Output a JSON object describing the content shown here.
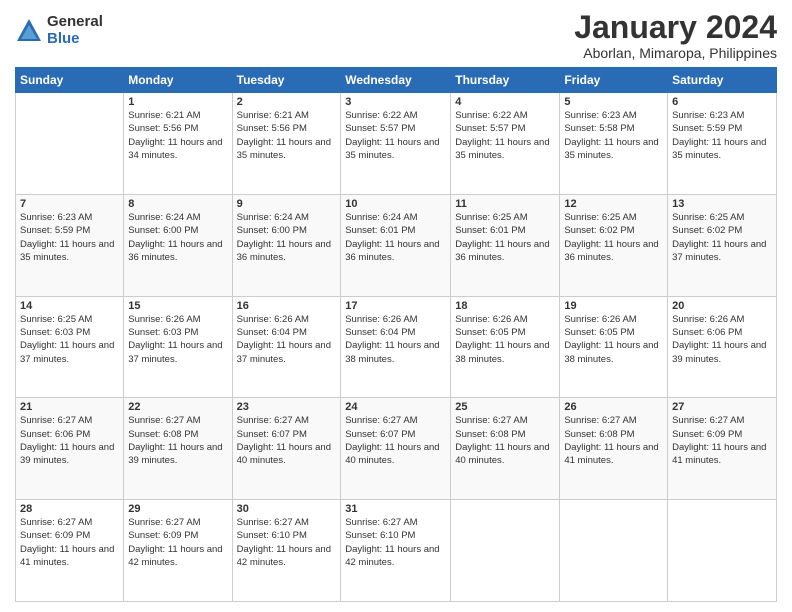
{
  "logo": {
    "general": "General",
    "blue": "Blue"
  },
  "header": {
    "title": "January 2024",
    "subtitle": "Aborlan, Mimaropa, Philippines"
  },
  "columns": [
    "Sunday",
    "Monday",
    "Tuesday",
    "Wednesday",
    "Thursday",
    "Friday",
    "Saturday"
  ],
  "weeks": [
    [
      {
        "day": "",
        "sunrise": "",
        "sunset": "",
        "daylight": ""
      },
      {
        "day": "1",
        "sunrise": "Sunrise: 6:21 AM",
        "sunset": "Sunset: 5:56 PM",
        "daylight": "Daylight: 11 hours and 34 minutes."
      },
      {
        "day": "2",
        "sunrise": "Sunrise: 6:21 AM",
        "sunset": "Sunset: 5:56 PM",
        "daylight": "Daylight: 11 hours and 35 minutes."
      },
      {
        "day": "3",
        "sunrise": "Sunrise: 6:22 AM",
        "sunset": "Sunset: 5:57 PM",
        "daylight": "Daylight: 11 hours and 35 minutes."
      },
      {
        "day": "4",
        "sunrise": "Sunrise: 6:22 AM",
        "sunset": "Sunset: 5:57 PM",
        "daylight": "Daylight: 11 hours and 35 minutes."
      },
      {
        "day": "5",
        "sunrise": "Sunrise: 6:23 AM",
        "sunset": "Sunset: 5:58 PM",
        "daylight": "Daylight: 11 hours and 35 minutes."
      },
      {
        "day": "6",
        "sunrise": "Sunrise: 6:23 AM",
        "sunset": "Sunset: 5:59 PM",
        "daylight": "Daylight: 11 hours and 35 minutes."
      }
    ],
    [
      {
        "day": "7",
        "sunrise": "Sunrise: 6:23 AM",
        "sunset": "Sunset: 5:59 PM",
        "daylight": "Daylight: 11 hours and 35 minutes."
      },
      {
        "day": "8",
        "sunrise": "Sunrise: 6:24 AM",
        "sunset": "Sunset: 6:00 PM",
        "daylight": "Daylight: 11 hours and 36 minutes."
      },
      {
        "day": "9",
        "sunrise": "Sunrise: 6:24 AM",
        "sunset": "Sunset: 6:00 PM",
        "daylight": "Daylight: 11 hours and 36 minutes."
      },
      {
        "day": "10",
        "sunrise": "Sunrise: 6:24 AM",
        "sunset": "Sunset: 6:01 PM",
        "daylight": "Daylight: 11 hours and 36 minutes."
      },
      {
        "day": "11",
        "sunrise": "Sunrise: 6:25 AM",
        "sunset": "Sunset: 6:01 PM",
        "daylight": "Daylight: 11 hours and 36 minutes."
      },
      {
        "day": "12",
        "sunrise": "Sunrise: 6:25 AM",
        "sunset": "Sunset: 6:02 PM",
        "daylight": "Daylight: 11 hours and 36 minutes."
      },
      {
        "day": "13",
        "sunrise": "Sunrise: 6:25 AM",
        "sunset": "Sunset: 6:02 PM",
        "daylight": "Daylight: 11 hours and 37 minutes."
      }
    ],
    [
      {
        "day": "14",
        "sunrise": "Sunrise: 6:25 AM",
        "sunset": "Sunset: 6:03 PM",
        "daylight": "Daylight: 11 hours and 37 minutes."
      },
      {
        "day": "15",
        "sunrise": "Sunrise: 6:26 AM",
        "sunset": "Sunset: 6:03 PM",
        "daylight": "Daylight: 11 hours and 37 minutes."
      },
      {
        "day": "16",
        "sunrise": "Sunrise: 6:26 AM",
        "sunset": "Sunset: 6:04 PM",
        "daylight": "Daylight: 11 hours and 37 minutes."
      },
      {
        "day": "17",
        "sunrise": "Sunrise: 6:26 AM",
        "sunset": "Sunset: 6:04 PM",
        "daylight": "Daylight: 11 hours and 38 minutes."
      },
      {
        "day": "18",
        "sunrise": "Sunrise: 6:26 AM",
        "sunset": "Sunset: 6:05 PM",
        "daylight": "Daylight: 11 hours and 38 minutes."
      },
      {
        "day": "19",
        "sunrise": "Sunrise: 6:26 AM",
        "sunset": "Sunset: 6:05 PM",
        "daylight": "Daylight: 11 hours and 38 minutes."
      },
      {
        "day": "20",
        "sunrise": "Sunrise: 6:26 AM",
        "sunset": "Sunset: 6:06 PM",
        "daylight": "Daylight: 11 hours and 39 minutes."
      }
    ],
    [
      {
        "day": "21",
        "sunrise": "Sunrise: 6:27 AM",
        "sunset": "Sunset: 6:06 PM",
        "daylight": "Daylight: 11 hours and 39 minutes."
      },
      {
        "day": "22",
        "sunrise": "Sunrise: 6:27 AM",
        "sunset": "Sunset: 6:08 PM",
        "daylight": "Daylight: 11 hours and 39 minutes."
      },
      {
        "day": "23",
        "sunrise": "Sunrise: 6:27 AM",
        "sunset": "Sunset: 6:07 PM",
        "daylight": "Daylight: 11 hours and 40 minutes."
      },
      {
        "day": "24",
        "sunrise": "Sunrise: 6:27 AM",
        "sunset": "Sunset: 6:07 PM",
        "daylight": "Daylight: 11 hours and 40 minutes."
      },
      {
        "day": "25",
        "sunrise": "Sunrise: 6:27 AM",
        "sunset": "Sunset: 6:08 PM",
        "daylight": "Daylight: 11 hours and 40 minutes."
      },
      {
        "day": "26",
        "sunrise": "Sunrise: 6:27 AM",
        "sunset": "Sunset: 6:08 PM",
        "daylight": "Daylight: 11 hours and 41 minutes."
      },
      {
        "day": "27",
        "sunrise": "Sunrise: 6:27 AM",
        "sunset": "Sunset: 6:09 PM",
        "daylight": "Daylight: 11 hours and 41 minutes."
      }
    ],
    [
      {
        "day": "28",
        "sunrise": "Sunrise: 6:27 AM",
        "sunset": "Sunset: 6:09 PM",
        "daylight": "Daylight: 11 hours and 41 minutes."
      },
      {
        "day": "29",
        "sunrise": "Sunrise: 6:27 AM",
        "sunset": "Sunset: 6:09 PM",
        "daylight": "Daylight: 11 hours and 42 minutes."
      },
      {
        "day": "30",
        "sunrise": "Sunrise: 6:27 AM",
        "sunset": "Sunset: 6:10 PM",
        "daylight": "Daylight: 11 hours and 42 minutes."
      },
      {
        "day": "31",
        "sunrise": "Sunrise: 6:27 AM",
        "sunset": "Sunset: 6:10 PM",
        "daylight": "Daylight: 11 hours and 42 minutes."
      },
      {
        "day": "",
        "sunrise": "",
        "sunset": "",
        "daylight": ""
      },
      {
        "day": "",
        "sunrise": "",
        "sunset": "",
        "daylight": ""
      },
      {
        "day": "",
        "sunrise": "",
        "sunset": "",
        "daylight": ""
      }
    ]
  ]
}
